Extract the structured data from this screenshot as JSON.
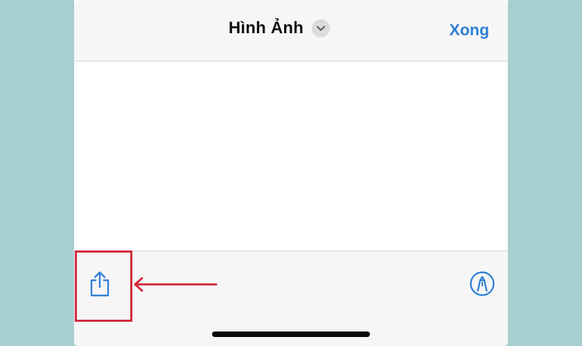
{
  "navbar": {
    "title": "Hình Ảnh",
    "done_label": "Xong",
    "title_menu_icon": "chevron-down-icon"
  },
  "toolbar": {
    "share_icon": "share-icon",
    "markup_icon": "markup-pen-icon"
  },
  "colors": {
    "background": "#a8cfcf",
    "accent": "#2f7fd6",
    "bar_background": "#f6f6f6",
    "annotation": "#d3283a"
  }
}
